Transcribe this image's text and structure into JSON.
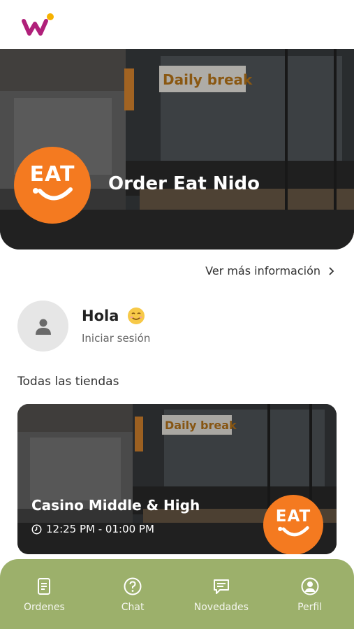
{
  "app": {
    "logo_icon": "brand-logo"
  },
  "hero": {
    "title": "Order Eat Nido",
    "sign_text": "Daily break",
    "badge_text": "EAT",
    "more_info": "Ver más información"
  },
  "greeting": {
    "hello": "Hola",
    "emoji": "😊",
    "login": "Iniciar sesión"
  },
  "stores": {
    "section_title": "Todas las tiendas",
    "items": [
      {
        "name": "Casino Middle & High",
        "hours": "12:25 PM - 01:00 PM",
        "badge_text": "EAT",
        "sign_text": "Daily break"
      }
    ]
  },
  "nav": {
    "items": [
      {
        "label": "Ordenes",
        "icon": "orders-icon"
      },
      {
        "label": "Chat",
        "icon": "help-icon"
      },
      {
        "label": "Novedades",
        "icon": "news-icon"
      },
      {
        "label": "Perfil",
        "icon": "profile-icon"
      }
    ]
  },
  "colors": {
    "accent_orange": "#f47a20",
    "nav_green": "#9cb06b",
    "logo_magenta": "#b0207a",
    "logo_yellow": "#f6b100"
  }
}
